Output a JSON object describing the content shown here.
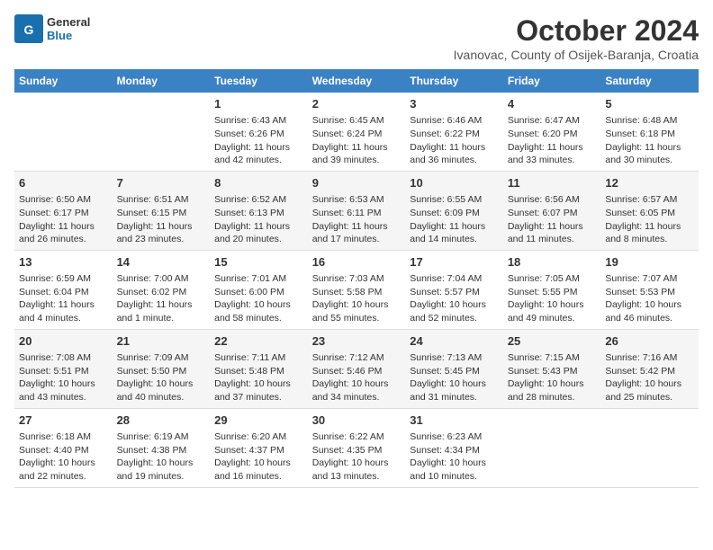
{
  "header": {
    "logo_general": "General",
    "logo_blue": "Blue",
    "title": "October 2024",
    "subtitle": "Ivanovac, County of Osijek-Baranja, Croatia"
  },
  "days_of_week": [
    "Sunday",
    "Monday",
    "Tuesday",
    "Wednesday",
    "Thursday",
    "Friday",
    "Saturday"
  ],
  "weeks": [
    [
      {
        "day": "",
        "sunrise": "",
        "sunset": "",
        "daylight": ""
      },
      {
        "day": "",
        "sunrise": "",
        "sunset": "",
        "daylight": ""
      },
      {
        "day": "1",
        "sunrise": "Sunrise: 6:43 AM",
        "sunset": "Sunset: 6:26 PM",
        "daylight": "Daylight: 11 hours and 42 minutes."
      },
      {
        "day": "2",
        "sunrise": "Sunrise: 6:45 AM",
        "sunset": "Sunset: 6:24 PM",
        "daylight": "Daylight: 11 hours and 39 minutes."
      },
      {
        "day": "3",
        "sunrise": "Sunrise: 6:46 AM",
        "sunset": "Sunset: 6:22 PM",
        "daylight": "Daylight: 11 hours and 36 minutes."
      },
      {
        "day": "4",
        "sunrise": "Sunrise: 6:47 AM",
        "sunset": "Sunset: 6:20 PM",
        "daylight": "Daylight: 11 hours and 33 minutes."
      },
      {
        "day": "5",
        "sunrise": "Sunrise: 6:48 AM",
        "sunset": "Sunset: 6:18 PM",
        "daylight": "Daylight: 11 hours and 30 minutes."
      }
    ],
    [
      {
        "day": "6",
        "sunrise": "Sunrise: 6:50 AM",
        "sunset": "Sunset: 6:17 PM",
        "daylight": "Daylight: 11 hours and 26 minutes."
      },
      {
        "day": "7",
        "sunrise": "Sunrise: 6:51 AM",
        "sunset": "Sunset: 6:15 PM",
        "daylight": "Daylight: 11 hours and 23 minutes."
      },
      {
        "day": "8",
        "sunrise": "Sunrise: 6:52 AM",
        "sunset": "Sunset: 6:13 PM",
        "daylight": "Daylight: 11 hours and 20 minutes."
      },
      {
        "day": "9",
        "sunrise": "Sunrise: 6:53 AM",
        "sunset": "Sunset: 6:11 PM",
        "daylight": "Daylight: 11 hours and 17 minutes."
      },
      {
        "day": "10",
        "sunrise": "Sunrise: 6:55 AM",
        "sunset": "Sunset: 6:09 PM",
        "daylight": "Daylight: 11 hours and 14 minutes."
      },
      {
        "day": "11",
        "sunrise": "Sunrise: 6:56 AM",
        "sunset": "Sunset: 6:07 PM",
        "daylight": "Daylight: 11 hours and 11 minutes."
      },
      {
        "day": "12",
        "sunrise": "Sunrise: 6:57 AM",
        "sunset": "Sunset: 6:05 PM",
        "daylight": "Daylight: 11 hours and 8 minutes."
      }
    ],
    [
      {
        "day": "13",
        "sunrise": "Sunrise: 6:59 AM",
        "sunset": "Sunset: 6:04 PM",
        "daylight": "Daylight: 11 hours and 4 minutes."
      },
      {
        "day": "14",
        "sunrise": "Sunrise: 7:00 AM",
        "sunset": "Sunset: 6:02 PM",
        "daylight": "Daylight: 11 hours and 1 minute."
      },
      {
        "day": "15",
        "sunrise": "Sunrise: 7:01 AM",
        "sunset": "Sunset: 6:00 PM",
        "daylight": "Daylight: 10 hours and 58 minutes."
      },
      {
        "day": "16",
        "sunrise": "Sunrise: 7:03 AM",
        "sunset": "Sunset: 5:58 PM",
        "daylight": "Daylight: 10 hours and 55 minutes."
      },
      {
        "day": "17",
        "sunrise": "Sunrise: 7:04 AM",
        "sunset": "Sunset: 5:57 PM",
        "daylight": "Daylight: 10 hours and 52 minutes."
      },
      {
        "day": "18",
        "sunrise": "Sunrise: 7:05 AM",
        "sunset": "Sunset: 5:55 PM",
        "daylight": "Daylight: 10 hours and 49 minutes."
      },
      {
        "day": "19",
        "sunrise": "Sunrise: 7:07 AM",
        "sunset": "Sunset: 5:53 PM",
        "daylight": "Daylight: 10 hours and 46 minutes."
      }
    ],
    [
      {
        "day": "20",
        "sunrise": "Sunrise: 7:08 AM",
        "sunset": "Sunset: 5:51 PM",
        "daylight": "Daylight: 10 hours and 43 minutes."
      },
      {
        "day": "21",
        "sunrise": "Sunrise: 7:09 AM",
        "sunset": "Sunset: 5:50 PM",
        "daylight": "Daylight: 10 hours and 40 minutes."
      },
      {
        "day": "22",
        "sunrise": "Sunrise: 7:11 AM",
        "sunset": "Sunset: 5:48 PM",
        "daylight": "Daylight: 10 hours and 37 minutes."
      },
      {
        "day": "23",
        "sunrise": "Sunrise: 7:12 AM",
        "sunset": "Sunset: 5:46 PM",
        "daylight": "Daylight: 10 hours and 34 minutes."
      },
      {
        "day": "24",
        "sunrise": "Sunrise: 7:13 AM",
        "sunset": "Sunset: 5:45 PM",
        "daylight": "Daylight: 10 hours and 31 minutes."
      },
      {
        "day": "25",
        "sunrise": "Sunrise: 7:15 AM",
        "sunset": "Sunset: 5:43 PM",
        "daylight": "Daylight: 10 hours and 28 minutes."
      },
      {
        "day": "26",
        "sunrise": "Sunrise: 7:16 AM",
        "sunset": "Sunset: 5:42 PM",
        "daylight": "Daylight: 10 hours and 25 minutes."
      }
    ],
    [
      {
        "day": "27",
        "sunrise": "Sunrise: 6:18 AM",
        "sunset": "Sunset: 4:40 PM",
        "daylight": "Daylight: 10 hours and 22 minutes."
      },
      {
        "day": "28",
        "sunrise": "Sunrise: 6:19 AM",
        "sunset": "Sunset: 4:38 PM",
        "daylight": "Daylight: 10 hours and 19 minutes."
      },
      {
        "day": "29",
        "sunrise": "Sunrise: 6:20 AM",
        "sunset": "Sunset: 4:37 PM",
        "daylight": "Daylight: 10 hours and 16 minutes."
      },
      {
        "day": "30",
        "sunrise": "Sunrise: 6:22 AM",
        "sunset": "Sunset: 4:35 PM",
        "daylight": "Daylight: 10 hours and 13 minutes."
      },
      {
        "day": "31",
        "sunrise": "Sunrise: 6:23 AM",
        "sunset": "Sunset: 4:34 PM",
        "daylight": "Daylight: 10 hours and 10 minutes."
      },
      {
        "day": "",
        "sunrise": "",
        "sunset": "",
        "daylight": ""
      },
      {
        "day": "",
        "sunrise": "",
        "sunset": "",
        "daylight": ""
      }
    ]
  ]
}
